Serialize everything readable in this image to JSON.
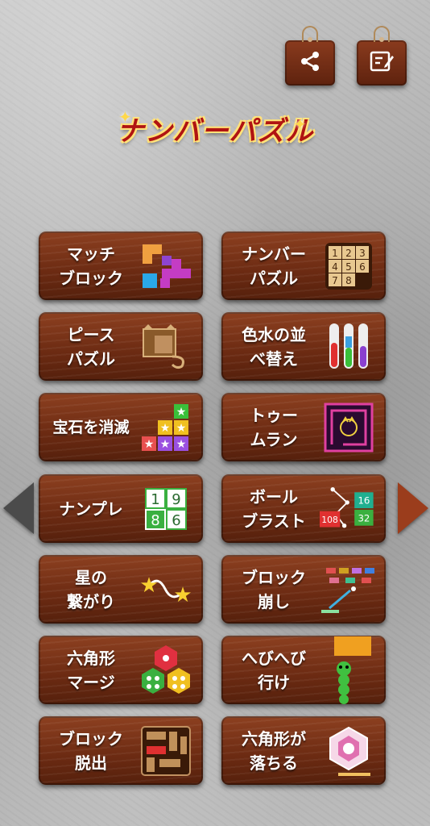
{
  "header": {
    "title": "ナンバーパズル",
    "share_icon": "share-icon",
    "memo_icon": "edit-memo-icon"
  },
  "games": [
    {
      "label": "マッチ\nブロック",
      "icon": "tetromino-blocks-icon"
    },
    {
      "label": "ナンバー\nパズル",
      "icon": "number-slide-puzzle-icon",
      "icon_numbers": [
        "1",
        "2",
        "3",
        "4",
        "5",
        "6",
        "7",
        "8"
      ]
    },
    {
      "label": "ピース\nパズル",
      "icon": "jigsaw-cat-icon"
    },
    {
      "label": "色水の並\nべ替え",
      "icon": "water-sort-tubes-icon"
    },
    {
      "label": "宝石を消滅",
      "icon": "star-gem-blocks-icon"
    },
    {
      "label": "トゥー\nムラン",
      "icon": "maze-cat-icon"
    },
    {
      "label": "ナンプレ",
      "icon": "sudoku-numbers-icon",
      "icon_numbers": [
        "1",
        "9",
        "8",
        "6"
      ]
    },
    {
      "label": "ボール\nブラスト",
      "icon": "ball-blast-icon",
      "icon_numbers": [
        "16",
        "108",
        "32"
      ]
    },
    {
      "label": "星の\n繋がり",
      "icon": "connect-stars-icon"
    },
    {
      "label": "ブロック\n崩し",
      "icon": "brick-breaker-icon"
    },
    {
      "label": "六角形\nマージ",
      "icon": "hexagon-merge-icon"
    },
    {
      "label": "へびへび\n行け",
      "icon": "snake-icon"
    },
    {
      "label": "ブロック\n脱出",
      "icon": "block-escape-icon"
    },
    {
      "label": "六角形が\n落ちる",
      "icon": "falling-hexagon-icon"
    }
  ],
  "nav": {
    "left_icon": "left-arrow-icon",
    "right_icon": "right-arrow-icon"
  },
  "colors": {
    "tile": "#6b2a12",
    "title": "#b01412",
    "title_outline": "#ffe27a"
  }
}
